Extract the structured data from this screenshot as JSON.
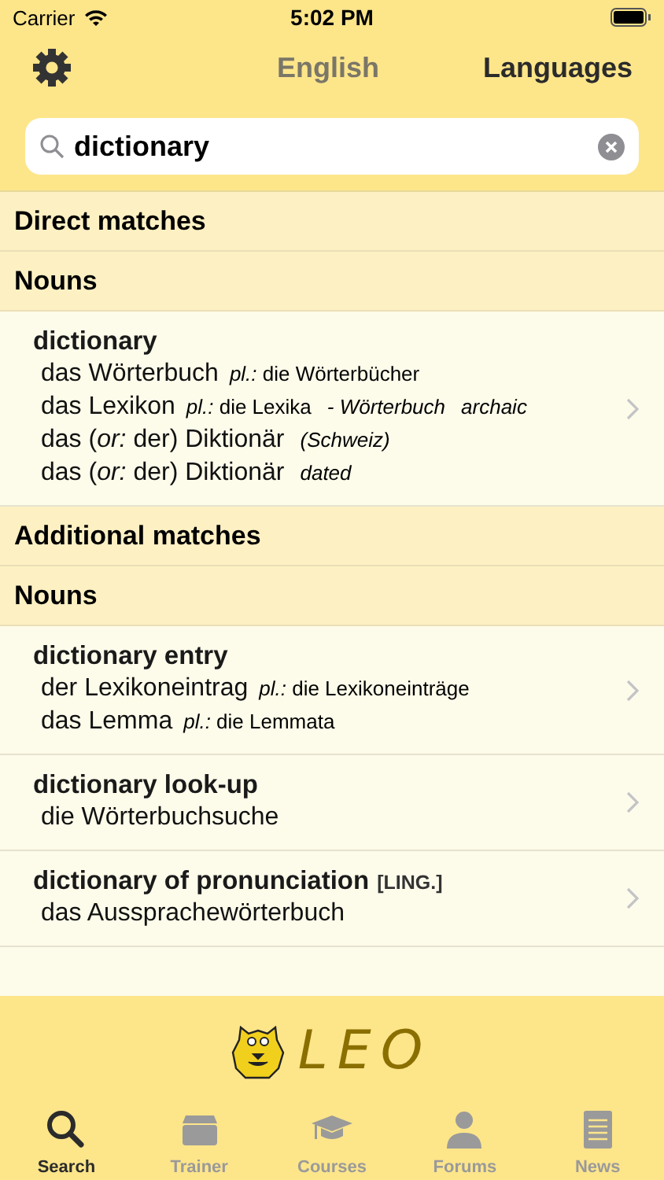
{
  "status_bar": {
    "carrier": "Carrier",
    "time": "5:02 PM"
  },
  "nav": {
    "language": "English",
    "languages_button": "Languages"
  },
  "search": {
    "value": "dictionary"
  },
  "sections": [
    {
      "title": "Direct matches",
      "groups": [
        {
          "title": "Nouns",
          "entries": [
            {
              "headword": "dictionary",
              "lines": [
                [
                  {
                    "kind": "term",
                    "text": "das Wörterbuch"
                  },
                  {
                    "kind": "note",
                    "text": "*pl.:* die Wörterbücher"
                  }
                ],
                [
                  {
                    "kind": "term",
                    "text": "das Lexikon"
                  },
                  {
                    "kind": "note",
                    "text": "*pl.:* die Lexika"
                  },
                  {
                    "kind": "label",
                    "text": "- Wörterbuch"
                  },
                  {
                    "kind": "label",
                    "text": "archaic"
                  }
                ],
                [
                  {
                    "kind": "term",
                    "text": "das (*or:* der) Diktionär"
                  },
                  {
                    "kind": "label",
                    "text": "(Schweiz)"
                  }
                ],
                [
                  {
                    "kind": "term",
                    "text": "das (*or:* der) Diktionär"
                  },
                  {
                    "kind": "label",
                    "text": "dated"
                  }
                ]
              ]
            }
          ]
        }
      ]
    },
    {
      "title": "Additional matches",
      "groups": [
        {
          "title": "Nouns",
          "entries": [
            {
              "headword": "dictionary entry",
              "lines": [
                [
                  {
                    "kind": "term",
                    "text": "der Lexikoneintrag"
                  },
                  {
                    "kind": "note",
                    "text": "*pl.:* die Lexikoneinträge"
                  }
                ],
                [
                  {
                    "kind": "term",
                    "text": "das Lemma"
                  },
                  {
                    "kind": "note",
                    "text": "*pl.:* die Lemmata"
                  }
                ]
              ]
            },
            {
              "headword": "dictionary look-up",
              "lines": [
                [
                  {
                    "kind": "term",
                    "text": "die Wörterbuchsuche"
                  }
                ]
              ]
            },
            {
              "headword": "dictionary of pronunciation",
              "tag": "[LING.]",
              "lines": [
                [
                  {
                    "kind": "term",
                    "text": "das Aussprachewörterbuch"
                  }
                ]
              ]
            }
          ]
        }
      ]
    }
  ],
  "logo_text": "LEO",
  "tabs": [
    {
      "label": "Search",
      "kind": "search",
      "selected": true
    },
    {
      "label": "Trainer",
      "kind": "trainer",
      "selected": false
    },
    {
      "label": "Courses",
      "kind": "courses",
      "selected": false
    },
    {
      "label": "Forums",
      "kind": "forums",
      "selected": false
    },
    {
      "label": "News",
      "kind": "news",
      "selected": false
    }
  ]
}
